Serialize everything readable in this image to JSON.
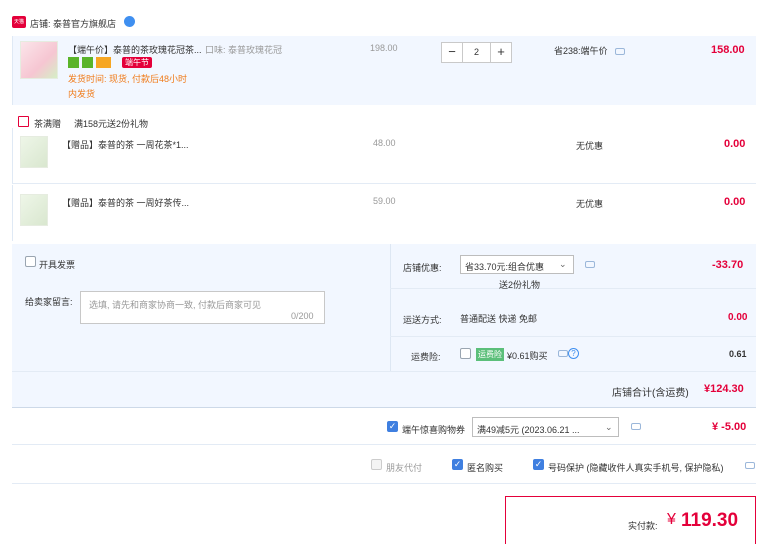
{
  "shop": {
    "label": "店铺: 泰普官方旗舰店",
    "badge": "天猫"
  },
  "item": {
    "title": "【端午价】泰普的茶玫瑰花冠茶...",
    "flavor": "口味: 泰普玫瑰花冠",
    "price": "198.00",
    "qty": "2",
    "save": "省238:端午价",
    "total": "158.00",
    "festival": "端午节",
    "ship1": "发货时间: 现货, 付款后48小时",
    "ship2": "内发货",
    "colors": {
      "accent": "#e4003a",
      "blue": "#3f7fe0",
      "orange": "#f07c1b"
    }
  },
  "gift_header": {
    "tag": "茶满赠",
    "text": "满158元送2份礼物"
  },
  "gifts": [
    {
      "title": "【赠品】泰普的茶 一周花茶*1...",
      "price": "48.00",
      "promo": "无优惠",
      "total": "0.00"
    },
    {
      "title": "【赠品】泰普的茶 一周好茶传...",
      "price": "59.00",
      "promo": "无优惠",
      "total": "0.00"
    }
  ],
  "options": {
    "invoice": "开具发票",
    "message_label": "给卖家留言:",
    "message_placeholder": "选填, 请先和商家协商一致, 付款后商家可见",
    "message_count": "0/200"
  },
  "shop_discount": {
    "label": "店铺优惠:",
    "select": "省33.70元:组合优惠",
    "sub": "送2份礼物",
    "amount": "-33.70"
  },
  "delivery": {
    "label": "运送方式:",
    "text": "普通配送 快递 免邮",
    "amount": "0.00"
  },
  "insurance": {
    "label": "运费险:",
    "tag": "运费险",
    "text": "¥0.61购买",
    "amount": "0.61"
  },
  "shop_total": {
    "label": "店铺合计(含运费)",
    "amount": "¥124.30"
  },
  "coupon": {
    "label": "端午惊喜购物券",
    "select": "满49减5元 (2023.06.21 ...",
    "amount": "¥ -5.00"
  },
  "footer_opts": {
    "friend": "朋友代付",
    "anon": "匿名购买",
    "privacy": "号码保护 (隐藏收件人真实手机号, 保护隐私)"
  },
  "pay": {
    "label": "实付款:",
    "currency": "¥",
    "amount": "119.30"
  }
}
